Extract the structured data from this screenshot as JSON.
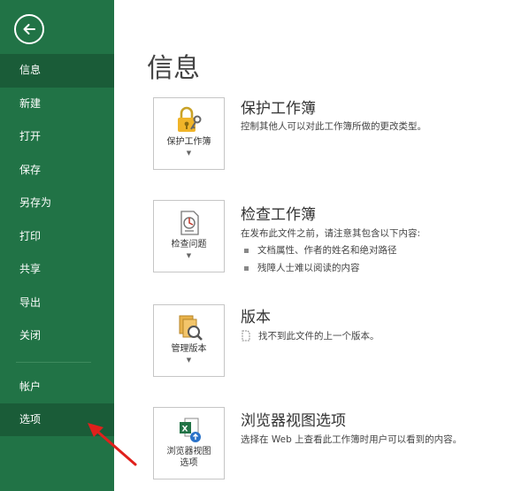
{
  "sidebar": {
    "items": [
      {
        "label": "信息",
        "active": true
      },
      {
        "label": "新建"
      },
      {
        "label": "打开"
      },
      {
        "label": "保存"
      },
      {
        "label": "另存为"
      },
      {
        "label": "打印"
      },
      {
        "label": "共享"
      },
      {
        "label": "导出"
      },
      {
        "label": "关闭"
      }
    ],
    "bottom_items": [
      {
        "label": "帐户"
      },
      {
        "label": "选项",
        "active": true
      }
    ]
  },
  "main": {
    "title": "信息",
    "protect": {
      "button_label": "保护工作簿",
      "title": "保护工作簿",
      "desc": "控制其他人可以对此工作簿所做的更改类型。"
    },
    "inspect": {
      "button_label": "检查问题",
      "title": "检查工作簿",
      "desc": "在发布此文件之前，请注意其包含以下内容:",
      "bullets": [
        "文档属性、作者的姓名和绝对路径",
        "残障人士难以阅读的内容"
      ]
    },
    "versions": {
      "button_label": "管理版本",
      "title": "版本",
      "desc": "找不到此文件的上一个版本。"
    },
    "browser": {
      "button_label_line1": "浏览器视图",
      "button_label_line2": "选项",
      "title": "浏览器视图选项",
      "desc": "选择在 Web 上查看此工作簿时用户可以看到的内容。"
    }
  },
  "colors": {
    "sidebar": "#217346",
    "sidebar_active": "#1a5c38",
    "annotation_arrow": "#e0201c"
  }
}
